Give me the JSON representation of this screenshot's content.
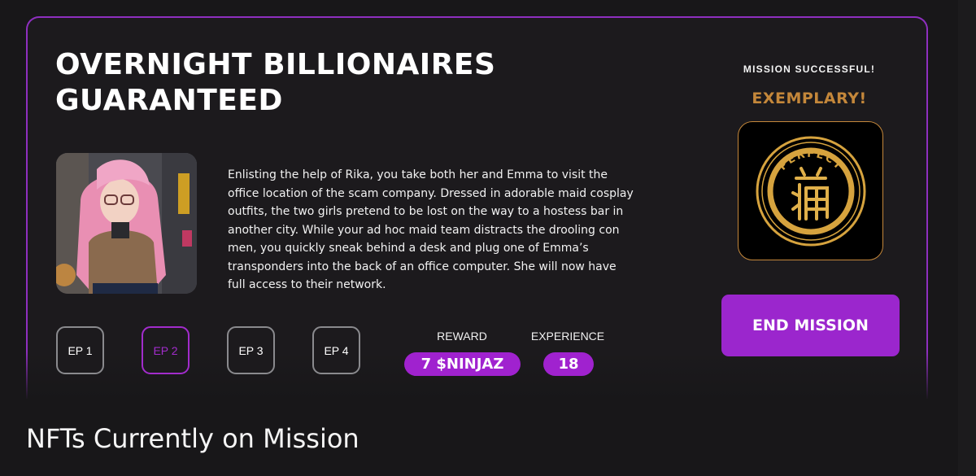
{
  "mission": {
    "title": "OVERNIGHT BILLIONAIRES GUARANTEED",
    "description": "Enlisting the help of Rika, you take both her and Emma to visit the office location of the scam company. Dressed in adorable maid cosplay outfits, the two girls pretend to be lost on the way to a hostess bar in another city. While your ad hoc maid team distracts the drooling con men, you quickly sneak behind a desk and plug one of Emma’s transponders into the back of an office computer. She will now have full access to their network.",
    "episodes": [
      {
        "label": "EP 1",
        "active": false
      },
      {
        "label": "EP 2",
        "active": true
      },
      {
        "label": "EP 3",
        "active": false
      },
      {
        "label": "EP 4",
        "active": false
      }
    ],
    "reward_label": "REWARD",
    "reward_value": "7 $NINJAZ",
    "experience_label": "EXPERIENCE",
    "experience_value": "18"
  },
  "result": {
    "status": "MISSION SUCCESSFUL!",
    "grade": "EXEMPLARY!",
    "badge_icon": "perfect-seal-icon",
    "badge_text": "PERFECT",
    "end_button": "END MISSION"
  },
  "section": {
    "title": "NFTs Currently on Mission"
  },
  "colors": {
    "accent": "#a022cf",
    "gold": "#c4873a",
    "background": "#181719"
  }
}
